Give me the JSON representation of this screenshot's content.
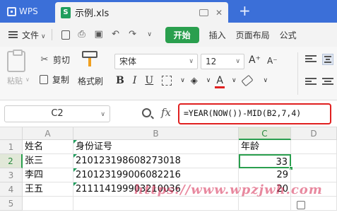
{
  "titlebar": {
    "app_tab": "WPS",
    "file_tab": "示例.xls",
    "add_tab": "+"
  },
  "menubar": {
    "file_label": "文件",
    "start_label": "开始",
    "items": [
      "插入",
      "页面布局",
      "公式"
    ]
  },
  "ribbon": {
    "paste_label": "粘贴",
    "cut_label": "剪切",
    "copy_label": "复制",
    "format_painter_label": "格式刷",
    "font_name": "宋体",
    "font_size": "12",
    "grow_label": "A⁺",
    "shrink_label": "A⁻",
    "bold_label": "B",
    "italic_label": "I",
    "underline_label": "U",
    "font_color_label": "A"
  },
  "formula_bar": {
    "name_box": "C2",
    "fx_label": "fx",
    "formula": "=YEAR(NOW())-MID(B2,7,4)"
  },
  "grid": {
    "columns": [
      "A",
      "B",
      "C",
      "D"
    ],
    "rows": [
      "1",
      "2",
      "3",
      "4",
      "5"
    ],
    "data": [
      [
        "姓名",
        "身份证号",
        "年龄",
        ""
      ],
      [
        "张三",
        "210123198608273018",
        "33",
        ""
      ],
      [
        "李四",
        "210123199006082216",
        "29",
        ""
      ],
      [
        "王五",
        "211114199903210036",
        "20",
        ""
      ],
      [
        "",
        "",
        "",
        ""
      ]
    ]
  },
  "watermark": "https://www.wpzjwh.com"
}
